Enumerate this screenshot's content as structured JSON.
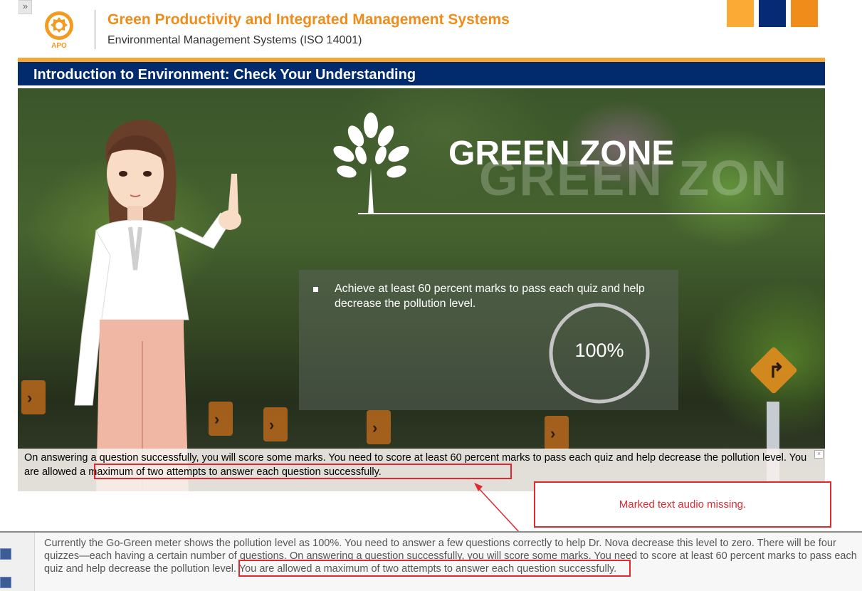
{
  "header": {
    "course_title": "Green Productivity and Integrated Management Systems",
    "course_subtitle": "Environmental Management Systems (ISO 14001)",
    "expand_glyph": "»",
    "logo_text": "APO"
  },
  "brand_colors": [
    "#fbaa35",
    "#062a73",
    "#f08c1a"
  ],
  "title_bar": {
    "page_title": "Introduction to Environment: Check Your Understanding"
  },
  "stage": {
    "zone_title": "GREEN ZONE",
    "zone_shadow": "GREEN ZON",
    "info_text": "Achieve at least 60 percent marks to pass each quiz and help decrease the pollution level.",
    "meter_label": "100%",
    "meter_fraction": 1.0
  },
  "caption": {
    "text_start": "On answering a question successfully, you will score some marks. You need to score at least 60 percent marks to pass each quiz and help decrease the pollution level. ",
    "text_highlighted": "You are allowed a maximum of two attempts to answer each question successfully.",
    "close_glyph": "×"
  },
  "annotation": {
    "callout_text": "Marked text audio missing.",
    "color": "#e0282e"
  },
  "notes": {
    "text_start": "Currently the Go-Green meter shows the pollution level as 100%. You need to answer a few questions correctly to help Dr. Nova decrease this level to zero. There will be four quizzes—each having a certain number of questions. On answering a question successfully, you will score some marks. You need to score at least 60 percent marks to pass each quiz and help decrease the pollution level. ",
    "text_highlighted": "You are allowed a maximum of two attempts to answer each question successfully."
  }
}
